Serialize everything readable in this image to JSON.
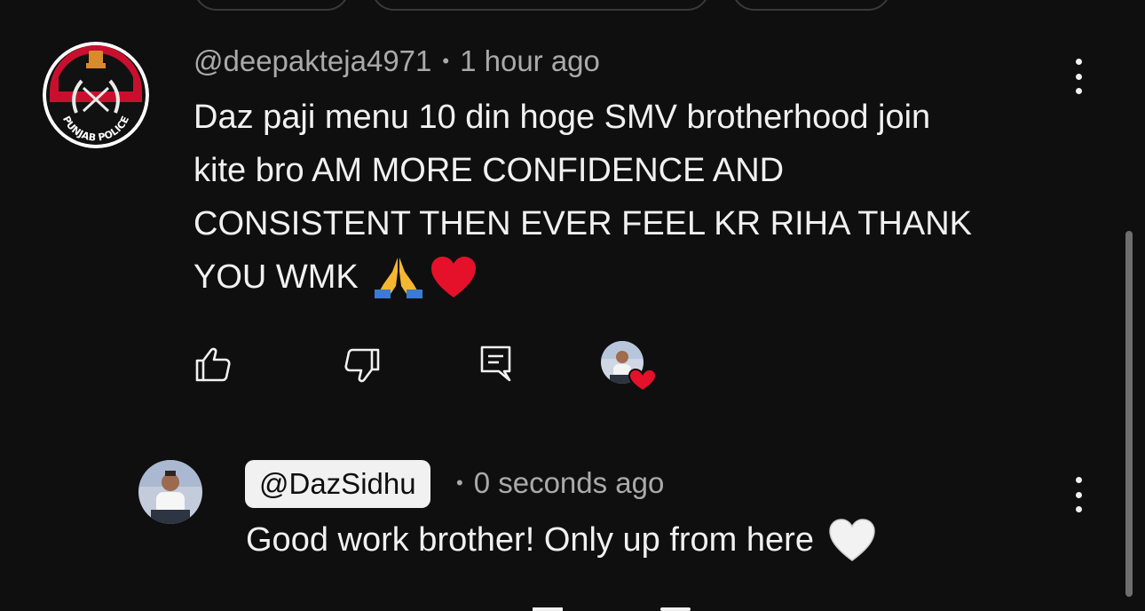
{
  "comment": {
    "author": "@deepakteja4971",
    "separator": "•",
    "time": "1 hour ago",
    "text_line1": "Daz paji menu 10 din hoge SMV brotherhood join",
    "text_line2": "kite bro AM MORE CONFIDENCE AND",
    "text_line3": "CONSISTENT THEN EVER FEEL KR RIHA THANK",
    "text_line4": "YOU WMK",
    "avatar_label": "PUNJAB POLICE",
    "icons": {
      "like": "thumbs-up-icon",
      "dislike": "thumbs-down-icon",
      "reply": "reply-comment-icon",
      "creator_heart": "creator-heart-icon",
      "more": "more-vertical-icon"
    }
  },
  "reply": {
    "author": "@DazSidhu",
    "separator": "•",
    "time": "0 seconds ago",
    "text": "Good work brother! Only up from here"
  },
  "colors": {
    "background": "#0f0f0f",
    "text": "#f1f1f1",
    "muted": "#aaaaaa",
    "heart": "#e5102a",
    "badge_red": "#c8102e"
  }
}
